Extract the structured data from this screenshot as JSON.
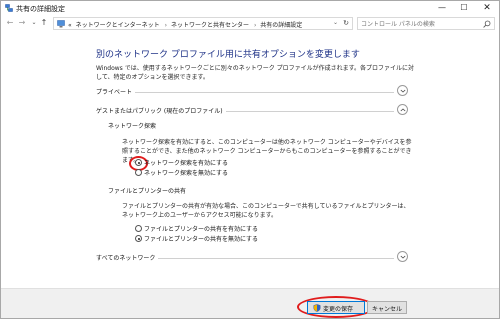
{
  "window": {
    "title": "共有の詳細設定",
    "minimize": "—",
    "maximize": "☐",
    "close": "✕"
  },
  "nav": {
    "back": "←",
    "forward": "→",
    "recent": "⌄",
    "up": "↑",
    "breadcrumb_prefix": "«",
    "breadcrumbs": [
      "ネットワークとインターネット",
      "ネットワークと共有センター",
      "共有の詳細設定"
    ],
    "breadcrumb_separator": "›",
    "dropdown": "⌄",
    "refresh": "↻",
    "search_placeholder": "コントロール パネルの検索"
  },
  "content": {
    "heading": "別のネットワーク プロファイル用に共有オプションを変更します",
    "intro": "Windows では、使用するネットワークごとに別々のネットワーク プロファイルが作成されます。各プロファイルに対して、特定のオプションを選択できます。",
    "sections": {
      "private": "プライベート",
      "guest_public": "ゲストまたはパブリック (現在のプロファイル)",
      "all_networks": "すべてのネットワーク"
    },
    "network_discovery": {
      "title": "ネットワーク探索",
      "description": "ネットワーク探索を有効にすると、このコンピューターは他のネットワーク コンピューターやデバイスを参照することができ、また他のネットワーク コンピューターからもこのコンピューターを参照することができます。",
      "options": [
        {
          "label": "ネットワーク探索を有効にする",
          "checked": true
        },
        {
          "label": "ネットワーク探索を無効にする",
          "checked": false
        }
      ]
    },
    "file_printer_sharing": {
      "title": "ファイルとプリンターの共有",
      "description": "ファイルとプリンターの共有が有効な場合、このコンピューターで共有しているファイルとプリンターは、ネットワーク上のユーザーからアクセス可能になります。",
      "options": [
        {
          "label": "ファイルとプリンターの共有を有効にする",
          "checked": false
        },
        {
          "label": "ファイルとプリンターの共有を無効にする",
          "checked": true
        }
      ]
    }
  },
  "footer": {
    "save_label": "変更の保存",
    "cancel_label": "キャンセル"
  },
  "colors": {
    "heading": "#1e3287",
    "highlight": "#e01c1c",
    "focus_border": "#0078d7"
  }
}
